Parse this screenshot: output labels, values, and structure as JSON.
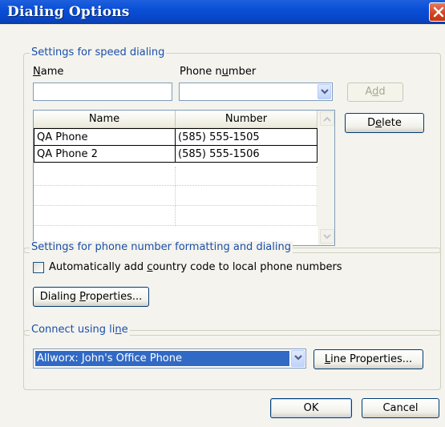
{
  "window": {
    "title": "Dialing Options",
    "close_icon": "close-icon",
    "colors": {
      "titlebar": "#0a4fd8",
      "legend": "#1b4fa8",
      "selection": "#316ac5",
      "close": "#d3421f"
    }
  },
  "speed_dialing": {
    "group_label": "Settings for speed dialing",
    "name_label_pre": "",
    "name_label_u": "N",
    "name_label_post": "ame",
    "phone_label_pre": "Phone n",
    "phone_label_u": "u",
    "phone_label_post": "mber",
    "name_value": "",
    "phone_value": "",
    "add_pre": "A",
    "add_u": "d",
    "add_post": "d",
    "delete_pre": "D",
    "delete_u": "e",
    "delete_post": "lete",
    "table": {
      "columns": [
        "Name",
        "Number"
      ],
      "rows": [
        {
          "name": "QA Phone",
          "number": "(585) 555-1505"
        },
        {
          "name": "QA Phone 2",
          "number": "(585) 555-1506"
        }
      ]
    }
  },
  "formatting": {
    "group_label": "Settings for phone number formatting and dialing",
    "checkbox_pre": "Automatically add ",
    "checkbox_u": "c",
    "checkbox_post": "ountry code to local phone numbers",
    "checkbox_checked": false,
    "dialing_props_pre": "Dialing ",
    "dialing_props_u": "P",
    "dialing_props_post": "roperties..."
  },
  "connect": {
    "group_label_pre": "Connect using li",
    "group_label_u": "n",
    "group_label_post": "e",
    "selected_line": "Allworx: John's Office Phone",
    "line_props_pre": "",
    "line_props_u": "L",
    "line_props_post": "ine Properties..."
  },
  "footer": {
    "ok_label": "OK",
    "cancel_label": "Cancel"
  }
}
